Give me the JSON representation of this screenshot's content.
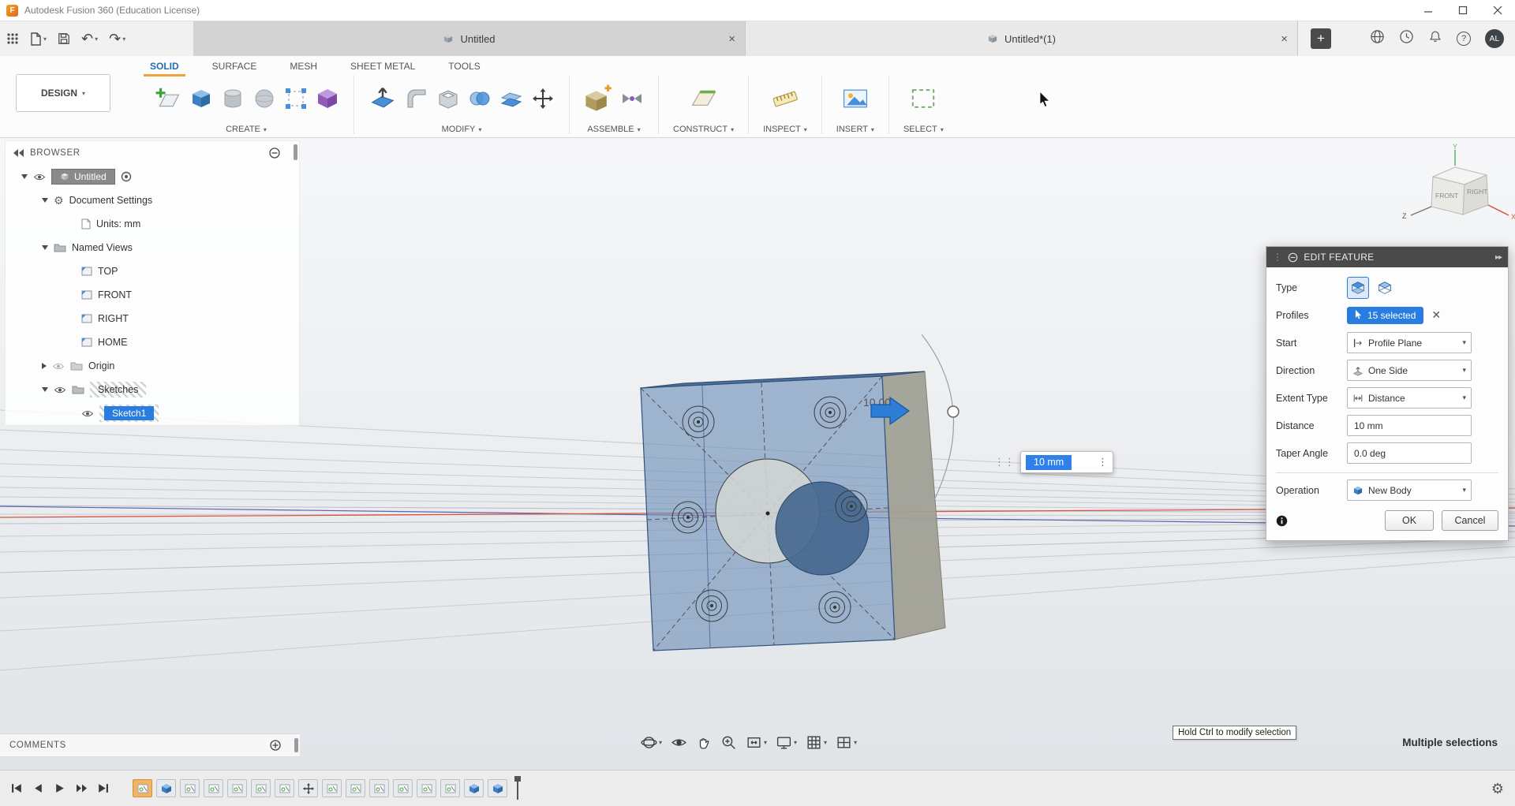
{
  "window": {
    "title": "Autodesk Fusion 360 (Education License)"
  },
  "tabbar": {
    "documents": [
      {
        "label": "Untitled"
      },
      {
        "label": "Untitled*(1)"
      }
    ],
    "new_tab": "+",
    "avatar": "AL"
  },
  "ribbon": {
    "design": "DESIGN",
    "tabs": [
      {
        "label": "SOLID"
      },
      {
        "label": "SURFACE"
      },
      {
        "label": "MESH"
      },
      {
        "label": "SHEET METAL"
      },
      {
        "label": "TOOLS"
      }
    ],
    "active_tab": "SOLID",
    "groups": [
      {
        "label": "CREATE"
      },
      {
        "label": "MODIFY"
      },
      {
        "label": "ASSEMBLE"
      },
      {
        "label": "CONSTRUCT"
      },
      {
        "label": "INSPECT"
      },
      {
        "label": "INSERT"
      },
      {
        "label": "SELECT"
      }
    ]
  },
  "browser": {
    "title": "BROWSER",
    "items": [
      {
        "label": "Untitled"
      },
      {
        "label": "Document Settings"
      },
      {
        "label": "Units: mm"
      },
      {
        "label": "Named Views"
      },
      {
        "label": "TOP"
      },
      {
        "label": "FRONT"
      },
      {
        "label": "RIGHT"
      },
      {
        "label": "HOME"
      },
      {
        "label": "Origin"
      },
      {
        "label": "Sketches"
      },
      {
        "label": "Sketch1"
      }
    ]
  },
  "viewcube": {
    "front": "FRONT",
    "right": "RIGHT",
    "x": "X",
    "y": "Y",
    "z": "Z"
  },
  "canvas": {
    "dimension_label": "10.00",
    "distance_input": "10 mm"
  },
  "dialog": {
    "title": "EDIT FEATURE",
    "rows": {
      "type": "Type",
      "profiles": "Profiles",
      "profiles_value": "15 selected",
      "start": "Start",
      "start_value": "Profile Plane",
      "direction": "Direction",
      "direction_value": "One Side",
      "extent": "Extent Type",
      "extent_value": "Distance",
      "distance": "Distance",
      "distance_value": "10 mm",
      "taper": "Taper Angle",
      "taper_value": "0.0 deg",
      "operation": "Operation",
      "operation_value": "New Body"
    },
    "ok": "OK",
    "cancel": "Cancel"
  },
  "footer": {
    "comments": "COMMENTS",
    "tooltip": "Hold Ctrl to modify selection",
    "selection_status": "Multiple selections"
  },
  "timeline": {
    "items": [
      "sketch-current",
      "extrude",
      "sketch",
      "sketch",
      "sketch",
      "sketch",
      "sketch",
      "move",
      "sketch",
      "sketch",
      "sketch",
      "sketch",
      "sketch",
      "sketch",
      "extrude",
      "extrude"
    ]
  },
  "colors": {
    "accent_blue": "#2a7de0",
    "accent_orange": "#f0a03c",
    "selection_blue": "#2f80e8",
    "tab_underline": "#f0a03c"
  }
}
